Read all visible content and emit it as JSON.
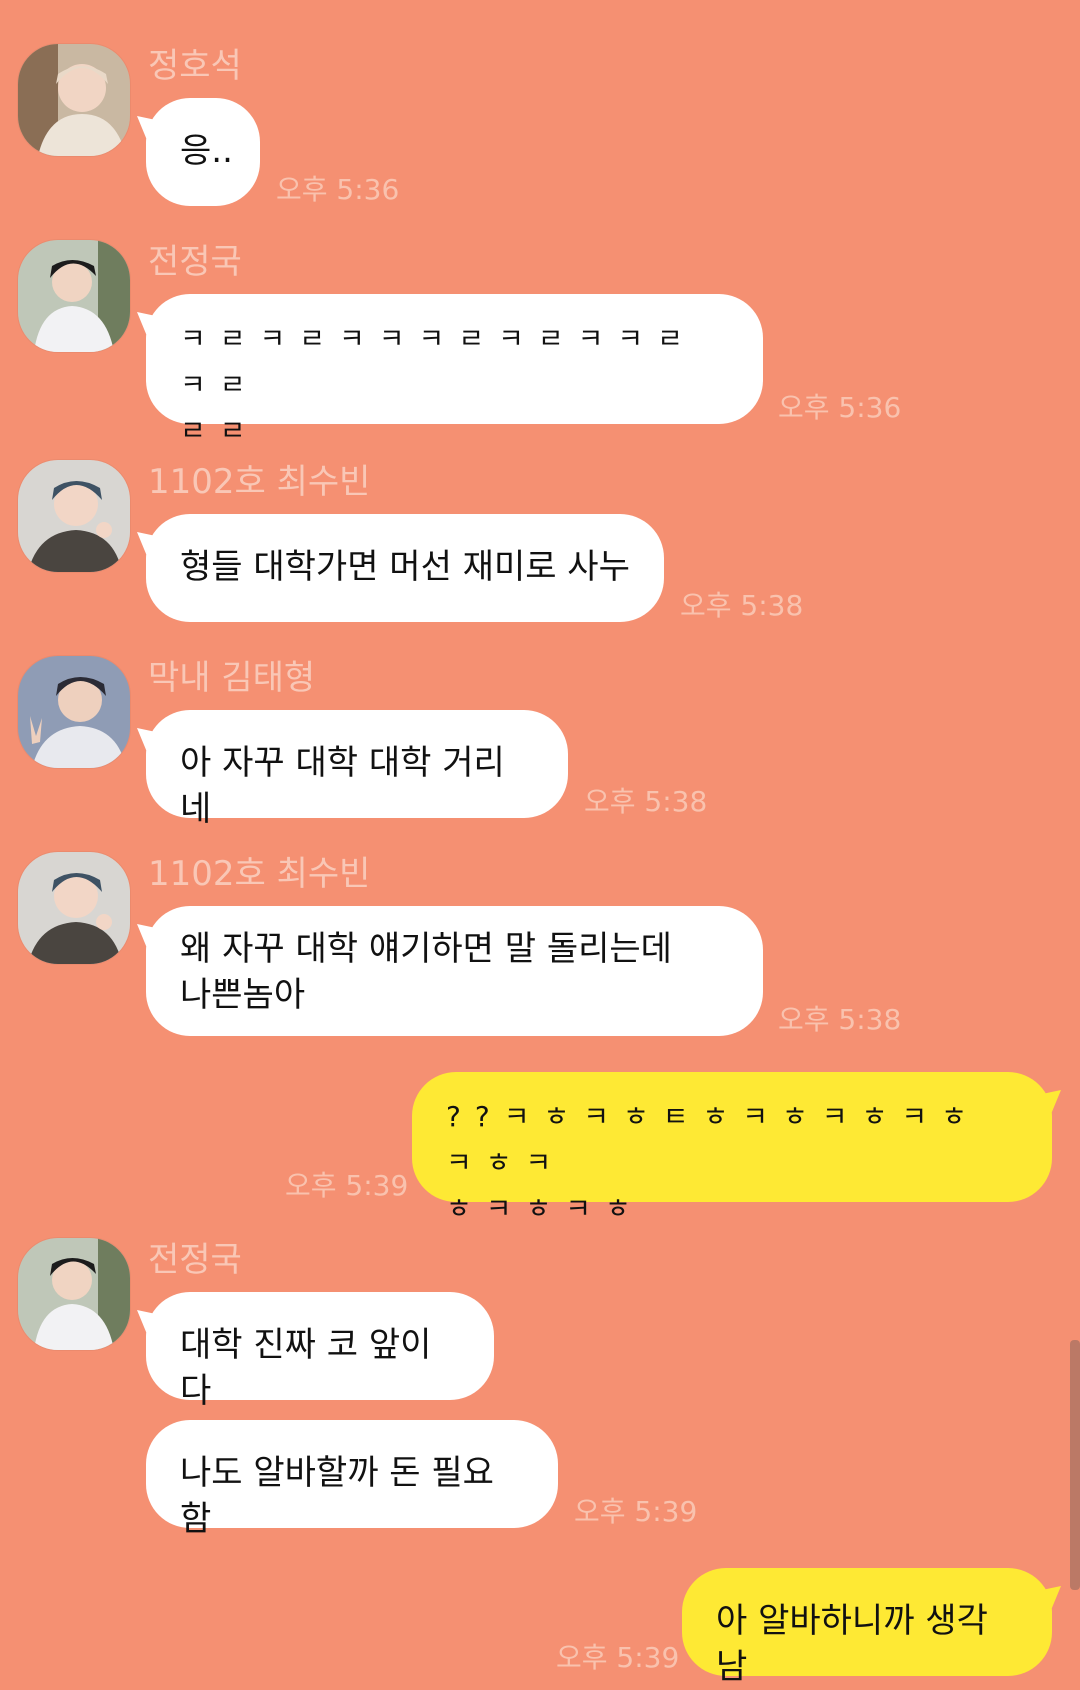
{
  "colors": {
    "background": "#F59072",
    "bubble_other": "#FFFFFF",
    "bubble_me": "#FEE934",
    "name_text": "#F9C7B6",
    "time_text": "#F9C2AE"
  },
  "messages": [
    {
      "sender": "정호석",
      "text": "응..",
      "time": "오후 5:36",
      "avatar_icon": "profile-photo-icon"
    },
    {
      "sender": "전정국",
      "text": "ㅋㄹㅋㄹㅋㅋㅋㄹㅋㄹㅋㅋㄹㅋㄹ\nㄹㄹ",
      "time": "오후 5:36",
      "avatar_icon": "profile-photo-icon"
    },
    {
      "sender": "1102호 최수빈",
      "text": "형들 대학가면 머선 재미로 사누",
      "time": "오후 5:38",
      "avatar_icon": "profile-photo-icon"
    },
    {
      "sender": "막내 김태형",
      "text": "아 자꾸 대학 대학 거리네",
      "time": "오후 5:38",
      "avatar_icon": "profile-photo-icon"
    },
    {
      "sender": "1102호 최수빈",
      "text": "왜 자꾸 대학 얘기하면 말 돌리는데\n나쁜놈아",
      "time": "오후 5:38",
      "avatar_icon": "profile-photo-icon"
    },
    {
      "sender": "",
      "text": "??ㅋㅎㅋㅎㅌㅎㅋㅎㅋㅎㅋㅎㅋㅎㅋ\nㅎㅋㅎㅋㅎ",
      "time": "오후 5:39"
    },
    {
      "sender": "전정국",
      "text": "대학 진짜 코 앞이다",
      "time": "",
      "avatar_icon": "profile-photo-icon"
    },
    {
      "sender": "",
      "text": "나도 알바할까 돈 필요함",
      "time": "오후 5:39"
    },
    {
      "sender": "",
      "text": "아 알바하니까 생각남",
      "time": "오후 5:39"
    }
  ]
}
